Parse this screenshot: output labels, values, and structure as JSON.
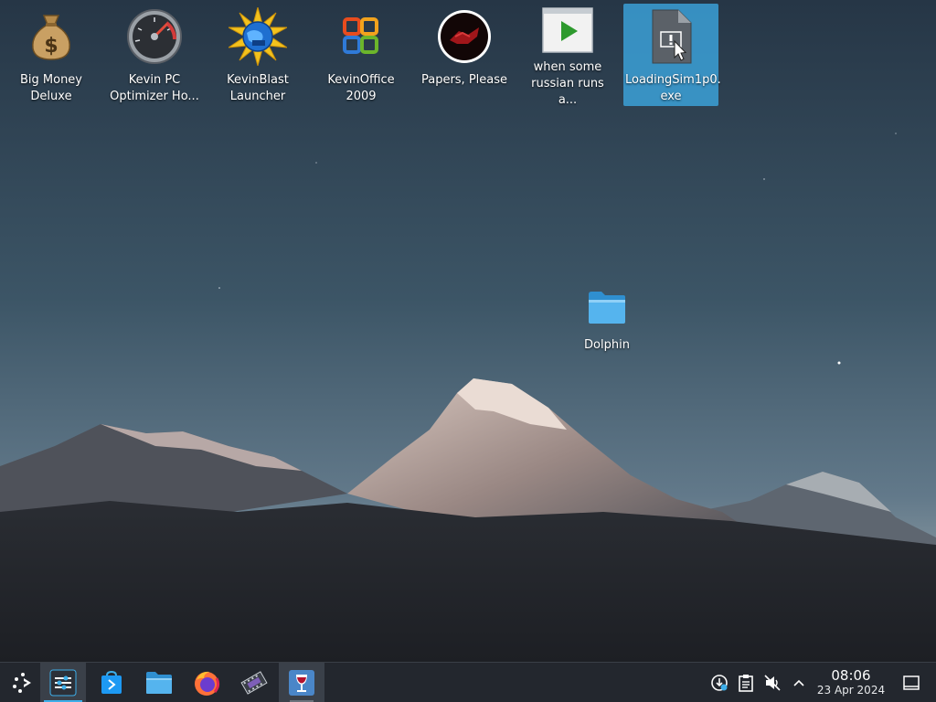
{
  "desktop": {
    "icons": [
      {
        "label": "Big Money\nDeluxe",
        "icon": "money-bag-icon"
      },
      {
        "label": "Kevin PC\nOptimizer Ho...",
        "icon": "speedometer-icon"
      },
      {
        "label": "KevinBlast\nLauncher",
        "icon": "globe-burst-icon"
      },
      {
        "label": "KevinOffice\n2009",
        "icon": "office-logo-icon"
      },
      {
        "label": "Papers, Please",
        "icon": "papers-please-emblem-icon"
      },
      {
        "label": "when some\nrussian runs a...",
        "icon": "video-play-icon"
      },
      {
        "label": "LoadingSim1p0.\nexe",
        "icon": "exe-file-icon",
        "selected": true
      }
    ],
    "folder": {
      "label": "Dolphin",
      "icon": "folder-icon"
    }
  },
  "taskbar": {
    "launcher": "application-launcher-icon",
    "tasks": [
      {
        "name": "system-settings-icon",
        "state": "active"
      },
      {
        "name": "discover-store-icon",
        "state": "pinned"
      },
      {
        "name": "dolphin-files-icon",
        "state": "pinned"
      },
      {
        "name": "firefox-icon",
        "state": "pinned"
      },
      {
        "name": "video-editor-icon",
        "state": "pinned"
      },
      {
        "name": "wine-glass-icon",
        "state": "running"
      }
    ],
    "tray": [
      "updates-icon",
      "clipboard-icon",
      "volume-muted-icon",
      "chevron-up-icon"
    ],
    "clock": {
      "time": "08:06",
      "date": "23 Apr 2024"
    },
    "show_desktop": "show-desktop-icon"
  },
  "colors": {
    "selection": "#3daee9",
    "panel": "#23272e"
  }
}
